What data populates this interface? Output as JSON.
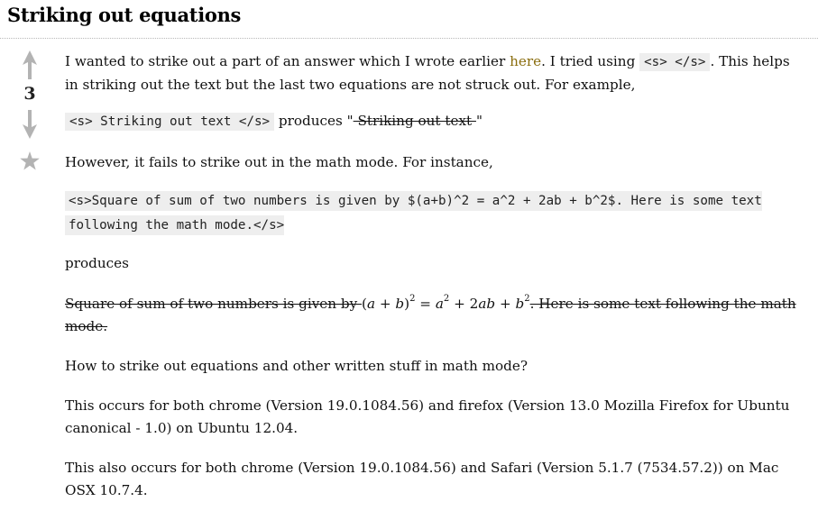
{
  "question": {
    "title": "Striking out equations"
  },
  "vote": {
    "count": "3",
    "upvote_icon": "arrow-up-icon",
    "downvote_icon": "arrow-down-icon",
    "favorite_icon": "star-icon",
    "icon_color": "#b3b3b3"
  },
  "post": {
    "p1": {
      "text_before_link": "I wanted to strike out a part of an answer which I wrote earlier ",
      "link_text": "here",
      "text_after_link": ". I tried using ",
      "code": "<s> </s>",
      "text_end": ". This helps in striking out the text but the last two equations are not struck out. For example,"
    },
    "p2": {
      "code": "<s> Striking out text </s>",
      "text_middle": " produces \"",
      "struck_text": " Striking out text ",
      "text_end": "\""
    },
    "p3": {
      "text": "However, it fails to strike out in the math mode. For instance,"
    },
    "code_block": {
      "text": " <s>Square of sum of two numbers is given by $(a+b)^2 = a^2 + 2ab + b^2$. Here is some text following the math mode.</s>"
    },
    "p4": {
      "text": "produces"
    },
    "p5": {
      "struck_before": "Square of sum of two numbers is given by ",
      "math_lhs_open": "(",
      "math_a": "a",
      "math_plus1": " + ",
      "math_b": "b",
      "math_lhs_close": ")",
      "math_exp1": "2",
      "math_eq": " = ",
      "math_a2": "a",
      "math_exp2": "2",
      "math_plus2": " + 2",
      "math_ab": "ab",
      "math_plus3": " + ",
      "math_b2": "b",
      "math_exp3": "2",
      "struck_after": ". Here is some text following the math mode."
    },
    "p6": {
      "text": "How to strike out equations and other written stuff in math mode?"
    },
    "p7": {
      "text": "This occurs for both chrome (Version 19.0.1084.56) and firefox (Version 13.0 Mozilla Firefox for Ubuntu canonical - 1.0) on Ubuntu 12.04."
    },
    "p8": {
      "text": "This also occurs for both chrome (Version 19.0.1084.56) and Safari (Version 5.1.7 (7534.57.2)) on Mac OSX 10.7.4."
    }
  },
  "colors": {
    "link": "#8a6d0e",
    "code_background": "#eeeeee"
  }
}
